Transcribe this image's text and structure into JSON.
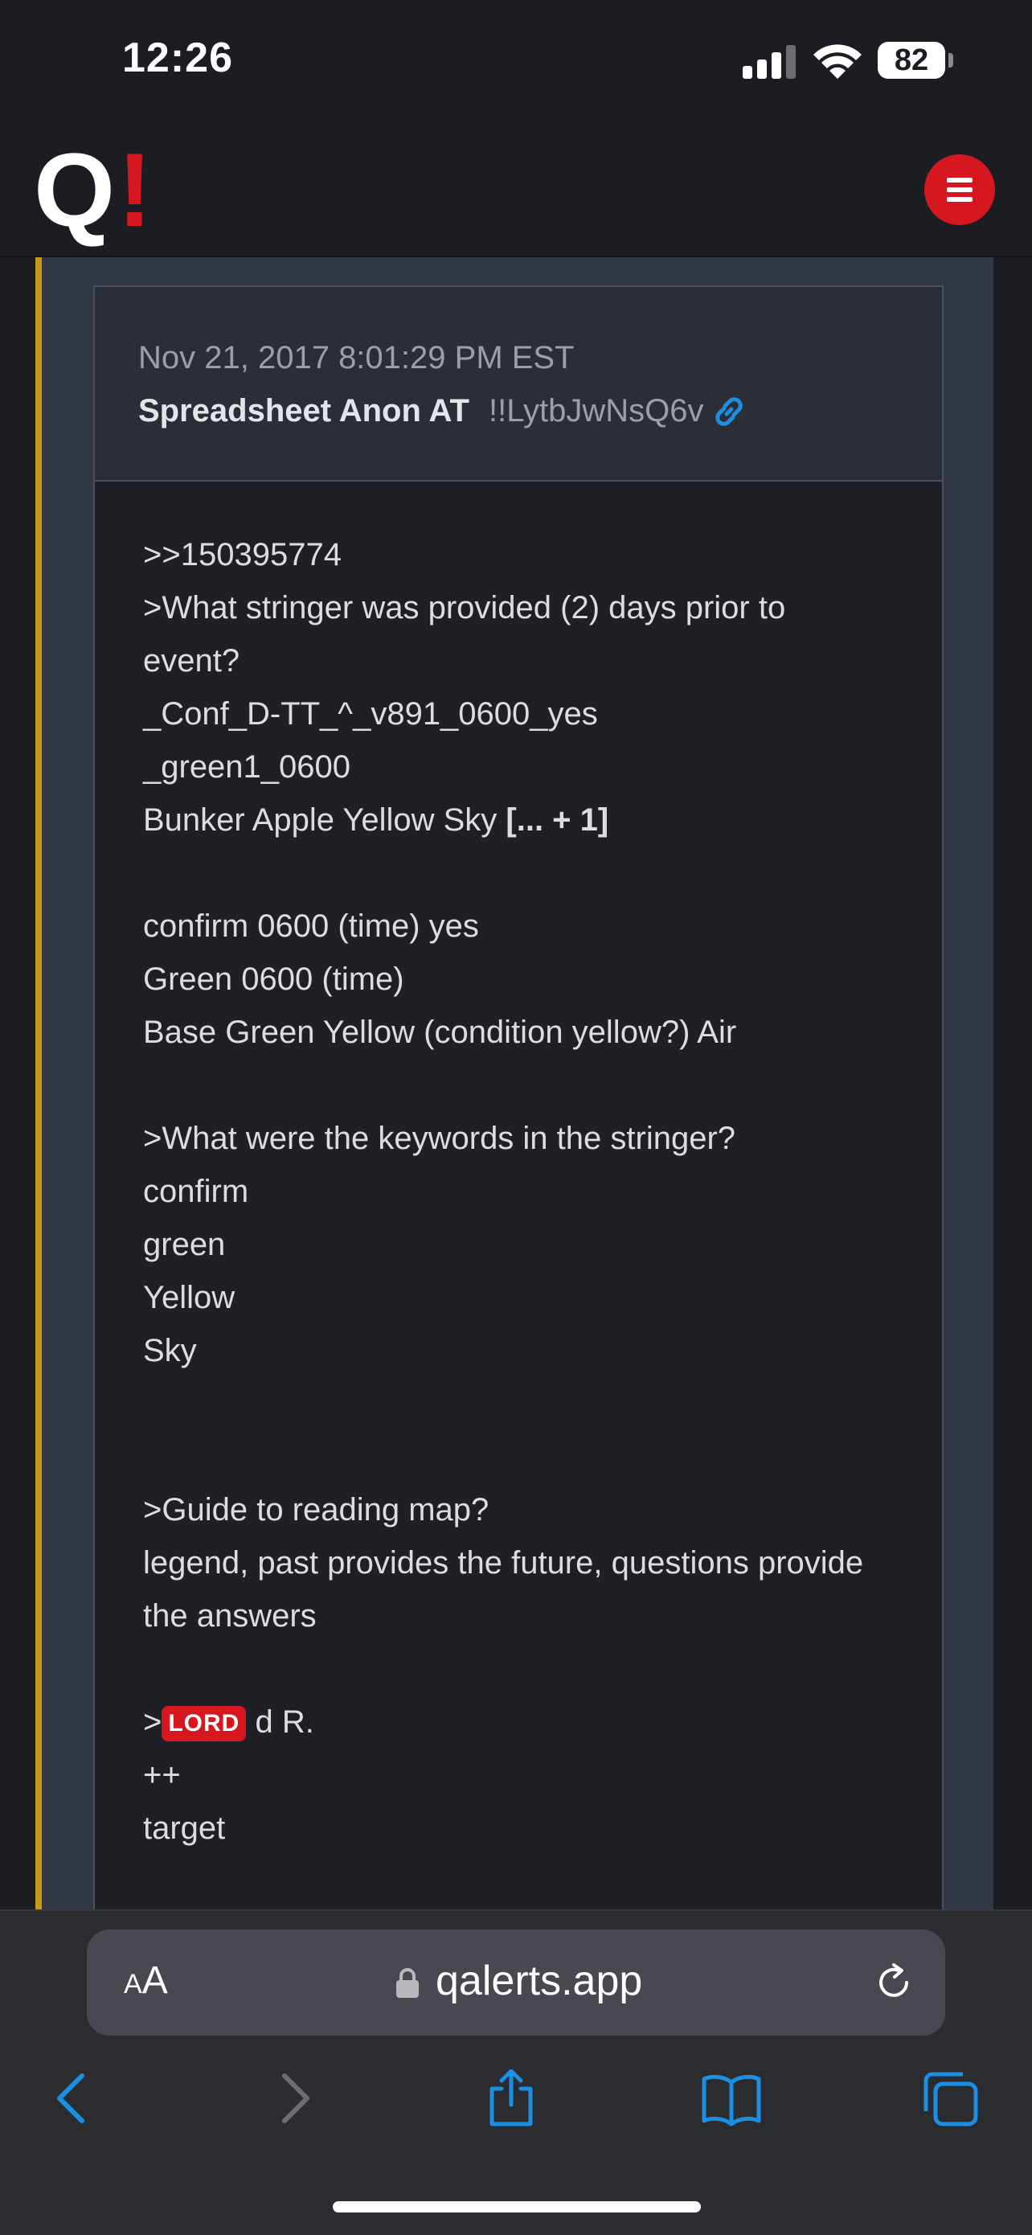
{
  "status_bar": {
    "time": "12:26",
    "battery": "82"
  },
  "app": {
    "logo_q": "Q",
    "logo_bang": "!"
  },
  "post": {
    "date": "Nov 21, 2017 8:01:29 PM EST",
    "author": "Spreadsheet Anon AT",
    "trip": "!!LytbJwNsQ6v",
    "lines": {
      "l1": ">>150395774",
      "l2": ">What stringer was provided (2) days prior to",
      "l3": "event?",
      "l4": "_Conf_D-TT_^_v891_0600_yes",
      "l5": "_green1_0600",
      "l6a": "Bunker Apple Yellow Sky ",
      "l6b": "[... + 1]",
      "l7": "confirm 0600 (time) yes",
      "l8": "Green 0600 (time)",
      "l9": "Base Green Yellow (condition yellow?) Air",
      "l10": ">What were the keywords in the stringer?",
      "l11": "confirm",
      "l12": "green",
      "l13": "Yellow",
      "l14": "Sky",
      "l15": ">Guide to reading map?",
      "l16": "legend, past provides the future, questions provide",
      "l17": "the answers",
      "l18a": ">",
      "l18_badge": "LORD",
      "l18b": " d R.",
      "l19": "++",
      "l20": "target"
    }
  },
  "browser": {
    "aa_small": "A",
    "aa_large": "A",
    "url": "qalerts.app"
  },
  "icons": {
    "signal": "cellular-signal-icon",
    "wifi": "wifi-icon",
    "menu": "hamburger-menu-icon",
    "link": "link-icon",
    "lock": "lock-icon",
    "reload": "reload-icon",
    "back": "back-chevron-icon",
    "forward": "forward-chevron-icon",
    "share": "share-icon",
    "bookmarks": "book-icon",
    "tabs": "tabs-icon"
  },
  "colors": {
    "accent_red": "#d7171f",
    "link_blue": "#1a8fe3",
    "gold_border": "#c59a1b"
  }
}
